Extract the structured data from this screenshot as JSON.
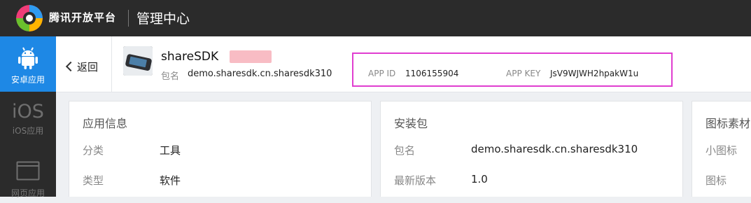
{
  "topbar": {
    "brand": "腾讯开放平台",
    "center": "管理中心",
    "colors": {
      "bg": "#2b2b2b",
      "text": "#ffffff"
    }
  },
  "sidebar": {
    "items": [
      {
        "label": "安卓应用",
        "icon": "android-icon",
        "active": true
      },
      {
        "label": "iOS应用",
        "icon": "ios-icon",
        "glyph": "iOS",
        "active": false
      },
      {
        "label": "网页应用",
        "icon": "browser-window-icon",
        "active": false
      }
    ],
    "colors": {
      "active": "#1e88e5"
    }
  },
  "subheader": {
    "back_label": "返回",
    "app_name": "shareSDK",
    "package_label": "包名",
    "package_value": "demo.sharesdk.cn.sharesdk310",
    "app_id_label": "APP ID",
    "app_id_value": "1106155904",
    "app_key_label": "APP KEY",
    "app_key_value": "JsV9WJWH2hpakW1u",
    "highlight_color": "#e03ed0"
  },
  "cards": {
    "app_info": {
      "title": "应用信息",
      "rows": [
        {
          "label": "分类",
          "value": "工具"
        },
        {
          "label": "类型",
          "value": "软件"
        }
      ]
    },
    "package": {
      "title": "安装包",
      "rows": [
        {
          "label": "包名",
          "value": "demo.sharesdk.cn.sharesdk310"
        },
        {
          "label": "最新版本",
          "value": "1.0"
        }
      ]
    },
    "icon_assets": {
      "title": "图标素材",
      "rows": [
        {
          "label": "小图标"
        },
        {
          "label": "图标"
        }
      ]
    }
  }
}
